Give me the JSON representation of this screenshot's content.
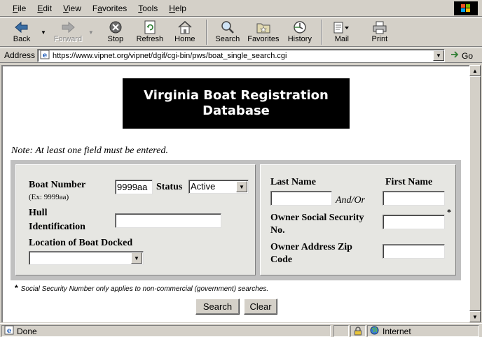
{
  "browser": {
    "menu": [
      {
        "ul": "F",
        "rest": "ile"
      },
      {
        "ul": "E",
        "rest": "dit"
      },
      {
        "ul": "V",
        "rest": "iew"
      },
      {
        "pre": "F",
        "ul": "a",
        "rest": "vorites"
      },
      {
        "ul": "T",
        "rest": "ools"
      },
      {
        "ul": "H",
        "rest": "elp"
      }
    ],
    "toolbar": {
      "back": "Back",
      "forward": "Forward",
      "stop": "Stop",
      "refresh": "Refresh",
      "home": "Home",
      "search": "Search",
      "favorites": "Favorites",
      "history": "History",
      "mail": "Mail",
      "print": "Print"
    },
    "address_label": "Address",
    "url": "https://www.vipnet.org/vipnet/dgif/cgi-bin/pws/boat_single_search.cgi",
    "go_label": "Go",
    "status_text": "Done",
    "zone_text": "Internet"
  },
  "page": {
    "title_line1": "Virginia Boat Registration",
    "title_line2": "Database",
    "note": "Note: At least one field must be entered.",
    "boat_number_label": "Boat Number",
    "boat_number_example": "(Ex: 9999aa)",
    "boat_number_value": "9999aa",
    "status_label": "Status",
    "status_value": "Active",
    "hull_label_1": "Hull",
    "hull_label_2": "Identification",
    "location_label": "Location of Boat Docked",
    "last_name_label": "Last Name",
    "first_name_label": "First Name",
    "and_or": "And/Or",
    "ssn_label_1": "Owner Social Security",
    "ssn_label_2": "No.",
    "ssn_asterisk": "*",
    "zip_label_1": "Owner Address Zip",
    "zip_label_2": "Code",
    "footnote_star": "*",
    "footnote": "Social Security Number only applies to non-commercial (government) searches.",
    "search_button": "Search",
    "clear_button": "Clear"
  }
}
